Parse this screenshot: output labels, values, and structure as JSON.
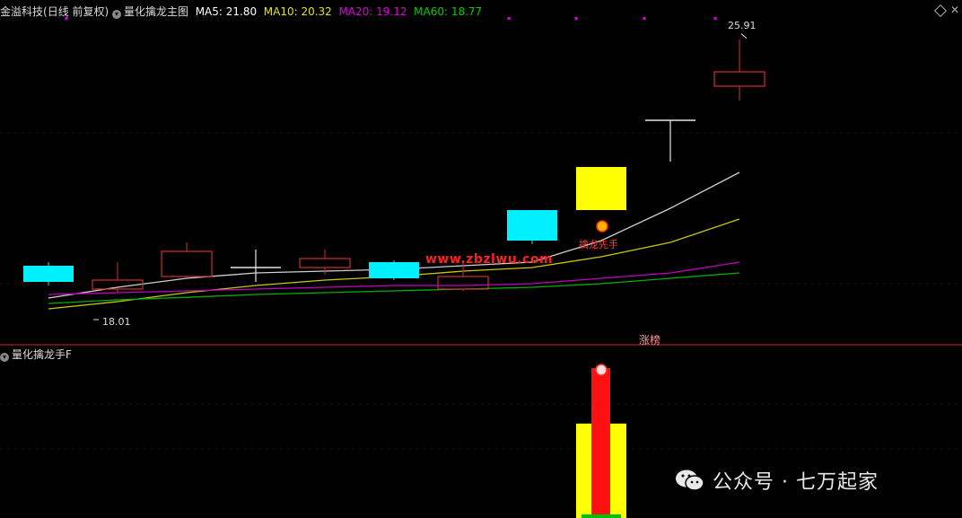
{
  "header": {
    "stock_name": "金溢科技",
    "period": "(日线 前复权)",
    "indicator": "量化擒龙主图",
    "ma5": "MA5: 21.80",
    "ma10": "MA10: 20.32",
    "ma20": "MA20: 19.12",
    "ma60": "MA60: 18.77",
    "ma5_color": "#ffffff",
    "ma10_color": "#e6e600",
    "ma20_color": "#e000e0",
    "ma60_color": "#00d000"
  },
  "sub_panel": {
    "title": "量化擒龙手F"
  },
  "annotations": {
    "high_price": "25.91",
    "low_price": "18.01",
    "signal_text": "擒龙先手",
    "limit_up": "涨榜",
    "watermark_url": "www.zbzlwu.com"
  },
  "watermark": {
    "text": "公众号 · 七万起家"
  },
  "chart_data": {
    "type": "candlestick",
    "price_range": [
      17.5,
      26.5
    ],
    "candles": [
      {
        "open": 19.6,
        "close": 19.15,
        "high": 19.7,
        "low": 19.05,
        "color": "cyan"
      },
      {
        "open": 18.95,
        "close": 19.2,
        "high": 19.7,
        "low": 18.85,
        "color": "red-hollow"
      },
      {
        "open": 19.3,
        "close": 20.0,
        "high": 20.25,
        "low": 19.25,
        "color": "red-hollow"
      },
      {
        "open": 19.55,
        "close": 19.55,
        "high": 20.05,
        "low": 19.15,
        "color": "doji"
      },
      {
        "open": 19.55,
        "close": 19.8,
        "high": 20.05,
        "low": 19.35,
        "color": "red-hollow"
      },
      {
        "open": 19.7,
        "close": 19.25,
        "high": 19.75,
        "low": 19.2,
        "color": "cyan"
      },
      {
        "open": 18.95,
        "close": 19.3,
        "high": 19.75,
        "low": 18.9,
        "color": "red-hollow"
      },
      {
        "open": 21.15,
        "close": 20.3,
        "high": 21.15,
        "low": 20.2,
        "color": "cyan"
      },
      {
        "open": 22.35,
        "close": 21.15,
        "high": 22.35,
        "low": 21.15,
        "color": "yellow"
      },
      {
        "open": 23.65,
        "close": 23.65,
        "high": 23.65,
        "low": 22.5,
        "color": "doji"
      },
      {
        "open": 24.6,
        "close": 25.0,
        "high": 25.91,
        "low": 24.2,
        "color": "red-hollow"
      }
    ],
    "ma_series": [
      {
        "name": "MA5",
        "color": "#cfcfcf",
        "values": [
          18.7,
          19.0,
          19.25,
          19.4,
          19.45,
          19.5,
          19.6,
          19.7,
          20.3,
          21.2,
          22.2
        ]
      },
      {
        "name": "MA10",
        "color": "#c8c800",
        "values": [
          18.4,
          18.6,
          18.85,
          19.05,
          19.2,
          19.3,
          19.45,
          19.55,
          19.85,
          20.25,
          20.9
        ]
      },
      {
        "name": "MA20",
        "color": "#c000c0",
        "values": [
          18.8,
          18.85,
          18.9,
          18.95,
          19.0,
          19.05,
          19.05,
          19.1,
          19.25,
          19.4,
          19.7
        ]
      },
      {
        "name": "MA60",
        "color": "#00b000",
        "values": [
          18.55,
          18.65,
          18.72,
          18.8,
          18.85,
          18.9,
          18.95,
          19.0,
          19.1,
          19.25,
          19.4
        ]
      }
    ],
    "signal_bar": {
      "candle_index": 8,
      "outer_level": 0.63,
      "inner_level": 1.0
    }
  }
}
